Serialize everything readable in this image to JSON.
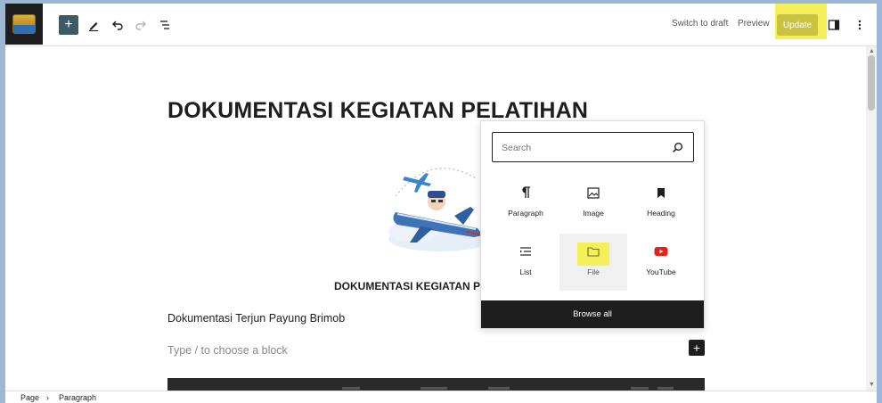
{
  "toolbar": {
    "add_label": "+",
    "switch_to_draft": "Switch to draft",
    "preview": "Preview",
    "update": "Update",
    "colors": {
      "highlight": "#f5ef5a",
      "update_bg": "#c9c340"
    }
  },
  "editor": {
    "title": "DOKUMENTASI KEGIATAN PELATIHAN",
    "image_caption": "DOKUMENTASI KEGIATAN P",
    "paragraph": "Dokumentasi Terjun Payung Brimob",
    "placeholder": "Type / to choose a block"
  },
  "inserter": {
    "search_placeholder": "Search",
    "blocks": [
      {
        "label": "Paragraph",
        "icon": "paragraph-icon"
      },
      {
        "label": "Image",
        "icon": "image-icon"
      },
      {
        "label": "Heading",
        "icon": "heading-icon"
      },
      {
        "label": "List",
        "icon": "list-icon"
      },
      {
        "label": "File",
        "icon": "file-folder-icon"
      },
      {
        "label": "YouTube",
        "icon": "youtube-icon"
      }
    ],
    "browse_all": "Browse all"
  },
  "breadcrumb": {
    "items": [
      "Page",
      "Paragraph"
    ],
    "separator": "›"
  }
}
